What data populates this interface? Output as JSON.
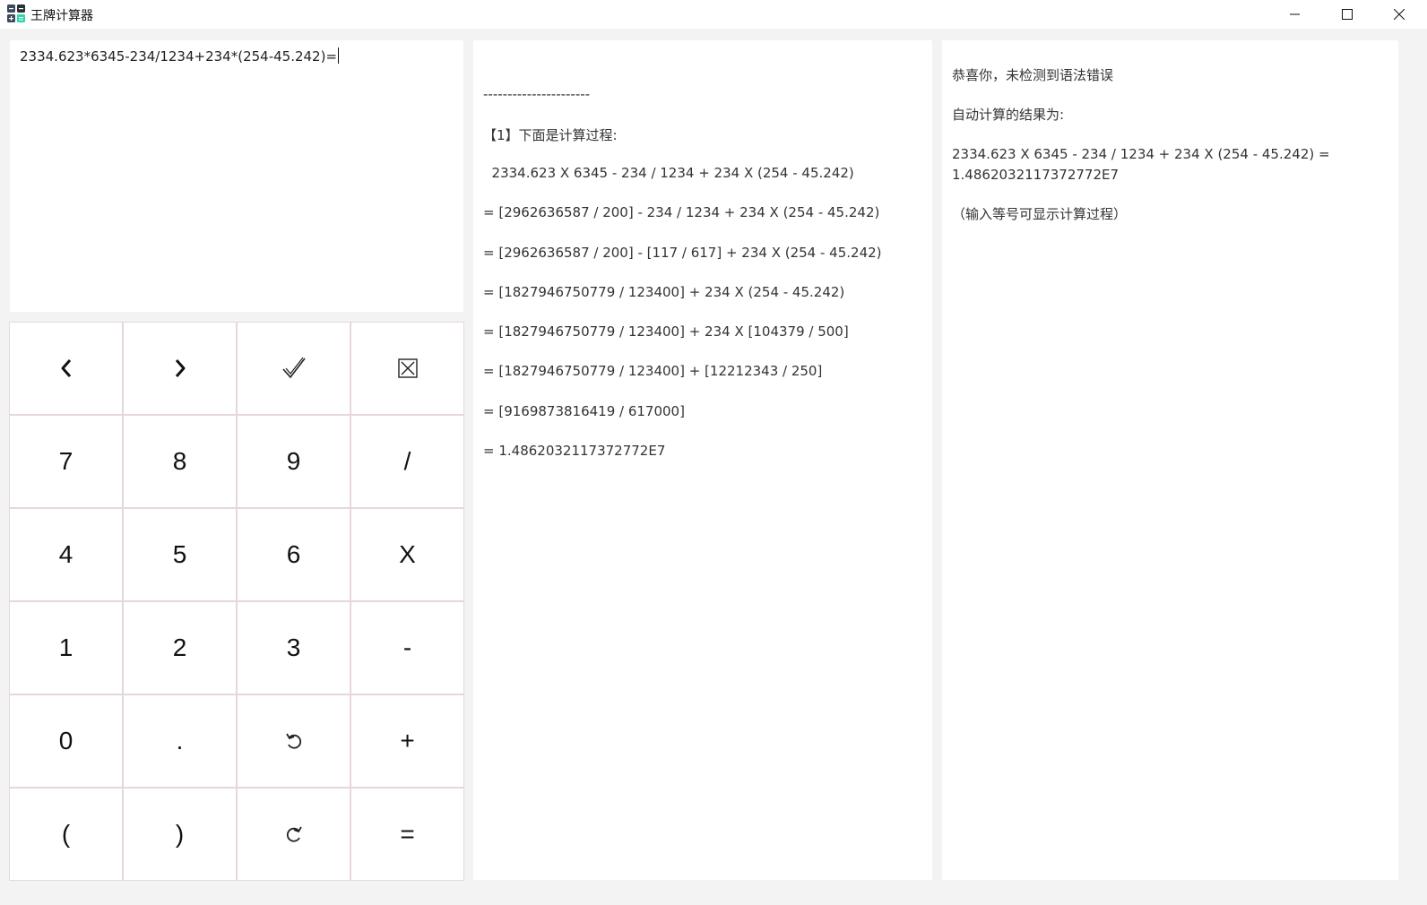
{
  "window": {
    "title": "王牌计算器"
  },
  "input": {
    "expression": "2334.623*6345-234/1234+234*(254-45.242)="
  },
  "keypad": {
    "keys": [
      {
        "label": "‹",
        "name": "cursor-left-key",
        "icon": "chevron-left-icon"
      },
      {
        "label": "›",
        "name": "cursor-right-key",
        "icon": "chevron-right-icon"
      },
      {
        "label": "✓",
        "name": "check-key",
        "icon": "checkmark-icon"
      },
      {
        "label": "☒",
        "name": "clear-key",
        "icon": "clear-box-icon"
      },
      {
        "label": "7",
        "name": "digit-7-key"
      },
      {
        "label": "8",
        "name": "digit-8-key"
      },
      {
        "label": "9",
        "name": "digit-9-key"
      },
      {
        "label": "/",
        "name": "divide-key"
      },
      {
        "label": "4",
        "name": "digit-4-key"
      },
      {
        "label": "5",
        "name": "digit-5-key"
      },
      {
        "label": "6",
        "name": "digit-6-key"
      },
      {
        "label": "X",
        "name": "multiply-key"
      },
      {
        "label": "1",
        "name": "digit-1-key"
      },
      {
        "label": "2",
        "name": "digit-2-key"
      },
      {
        "label": "3",
        "name": "digit-3-key"
      },
      {
        "label": "-",
        "name": "subtract-key"
      },
      {
        "label": "0",
        "name": "digit-0-key"
      },
      {
        "label": ".",
        "name": "decimal-key"
      },
      {
        "label": "↺",
        "name": "undo-key",
        "icon": "undo-icon"
      },
      {
        "label": "+",
        "name": "add-key"
      },
      {
        "label": "(",
        "name": "open-paren-key"
      },
      {
        "label": ")",
        "name": "close-paren-key"
      },
      {
        "label": "↻",
        "name": "redo-key",
        "icon": "redo-icon"
      },
      {
        "label": "=",
        "name": "equals-key"
      }
    ]
  },
  "process": {
    "separator": "----------------------",
    "heading": "【1】下面是计算过程:",
    "lines": [
      "  2334.623 X 6345 - 234 / 1234 + 234 X (254 - 45.242)",
      "= [2962636587 / 200] - 234 / 1234 + 234 X (254 - 45.242)",
      "= [2962636587 / 200] - [117 / 617] + 234 X (254 - 45.242)",
      "= [1827946750779 / 123400] + 234 X (254 - 45.242)",
      "= [1827946750779 / 123400] + 234 X [104379 / 500]",
      "= [1827946750779 / 123400] + [12212343 / 250]",
      "= [9169873816419 / 617000]",
      "= 1.4862032117372772E7"
    ]
  },
  "result": {
    "message": "恭喜你，未检测到语法错误",
    "label": "自动计算的结果为:",
    "expression": "  2334.623 X 6345 - 234 / 1234 + 234 X (254 - 45.242) = 1.4862032117372772E7",
    "hint": "（输入等号可显示计算过程）"
  }
}
